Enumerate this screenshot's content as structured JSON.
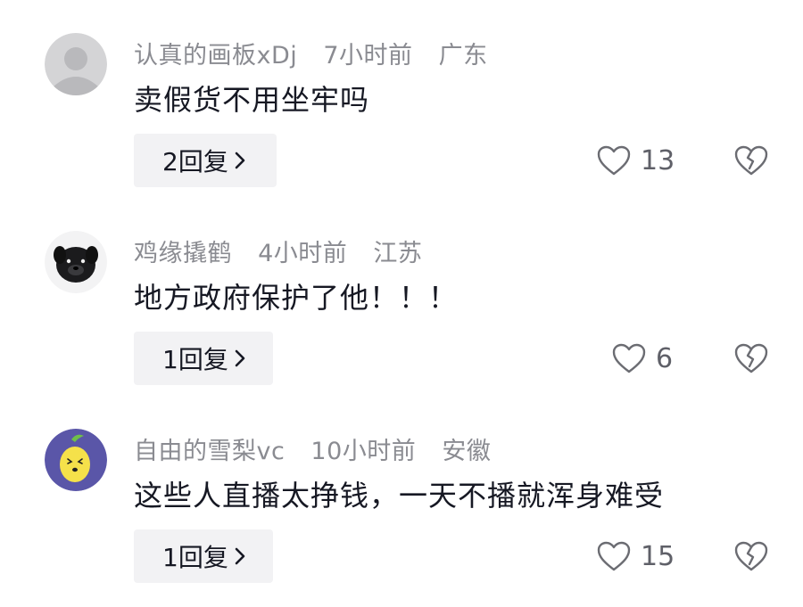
{
  "comments": [
    {
      "username": "认真的画板xDj",
      "time": "7小时前",
      "location": "广东",
      "text": "卖假货不用坐牢吗",
      "reply_label": "2回复",
      "likes": "13",
      "avatar": "default-gray-avatar"
    },
    {
      "username": "鸡缘撬鹤",
      "time": "4小时前",
      "location": "江苏",
      "text": "地方政府保护了他！！！",
      "reply_label": "1回复",
      "likes": "6",
      "avatar": "black-dog-avatar"
    },
    {
      "username": "自由的雪梨vc",
      "time": "10小时前",
      "location": "安徽",
      "text": "这些人直播太挣钱，一天不播就浑身难受",
      "reply_label": "1回复",
      "likes": "15",
      "avatar": "lemon-cartoon-avatar"
    }
  ],
  "icons": {
    "like": "heart-outline-icon",
    "dislike": "broken-heart-icon",
    "reply_chevron": "chevron-right-icon"
  }
}
